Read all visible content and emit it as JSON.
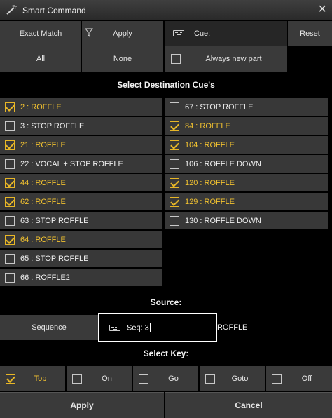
{
  "window": {
    "title": "Smart Command",
    "close_glyph": "×"
  },
  "toolbar": {
    "exact_match": "Exact Match",
    "apply": "Apply",
    "cue_label": "Cue:",
    "reset": "Reset",
    "all": "All",
    "none": "None",
    "always_new_part": "Always new part"
  },
  "destination_heading": "Select Destination Cue's",
  "cues_left": [
    {
      "label": "2 : ROFFLE",
      "checked": true
    },
    {
      "label": "3 : STOP ROFFLE",
      "checked": false
    },
    {
      "label": "21 : ROFFLE",
      "checked": true
    },
    {
      "label": "22 : VOCAL + STOP ROFFLE",
      "checked": false
    },
    {
      "label": "44 : ROFFLE",
      "checked": true
    },
    {
      "label": "62 : ROFFLE",
      "checked": true
    },
    {
      "label": "63 : STOP ROFFLE",
      "checked": false
    },
    {
      "label": "64 : ROFFLE",
      "checked": true
    },
    {
      "label": "65 : STOP ROFFLE",
      "checked": false
    },
    {
      "label": "66 : ROFFLE2",
      "checked": false
    }
  ],
  "cues_right": [
    {
      "label": "67 : STOP ROFFLE",
      "checked": false
    },
    {
      "label": "84 : ROFFLE",
      "checked": true
    },
    {
      "label": "104 : ROFFLE",
      "checked": true
    },
    {
      "label": "106 : ROFFLE DOWN",
      "checked": false
    },
    {
      "label": "120 : ROFFLE",
      "checked": true
    },
    {
      "label": "129 : ROFFLE",
      "checked": true
    },
    {
      "label": "130 : ROFFLE DOWN",
      "checked": false
    }
  ],
  "source": {
    "heading": "Source:",
    "sequence_button": "Sequence",
    "seq_value": "Seq: 3",
    "seq_name": "ROFFLE"
  },
  "key": {
    "heading": "Select Key:",
    "options": [
      {
        "label": "Top",
        "checked": true
      },
      {
        "label": "On",
        "checked": false
      },
      {
        "label": "Go",
        "checked": false
      },
      {
        "label": "Goto",
        "checked": false
      },
      {
        "label": "Off",
        "checked": false
      }
    ]
  },
  "footer": {
    "apply": "Apply",
    "cancel": "Cancel"
  },
  "colors": {
    "accent": "#f2c230",
    "button": "#3a3a3a",
    "background": "#000000"
  }
}
